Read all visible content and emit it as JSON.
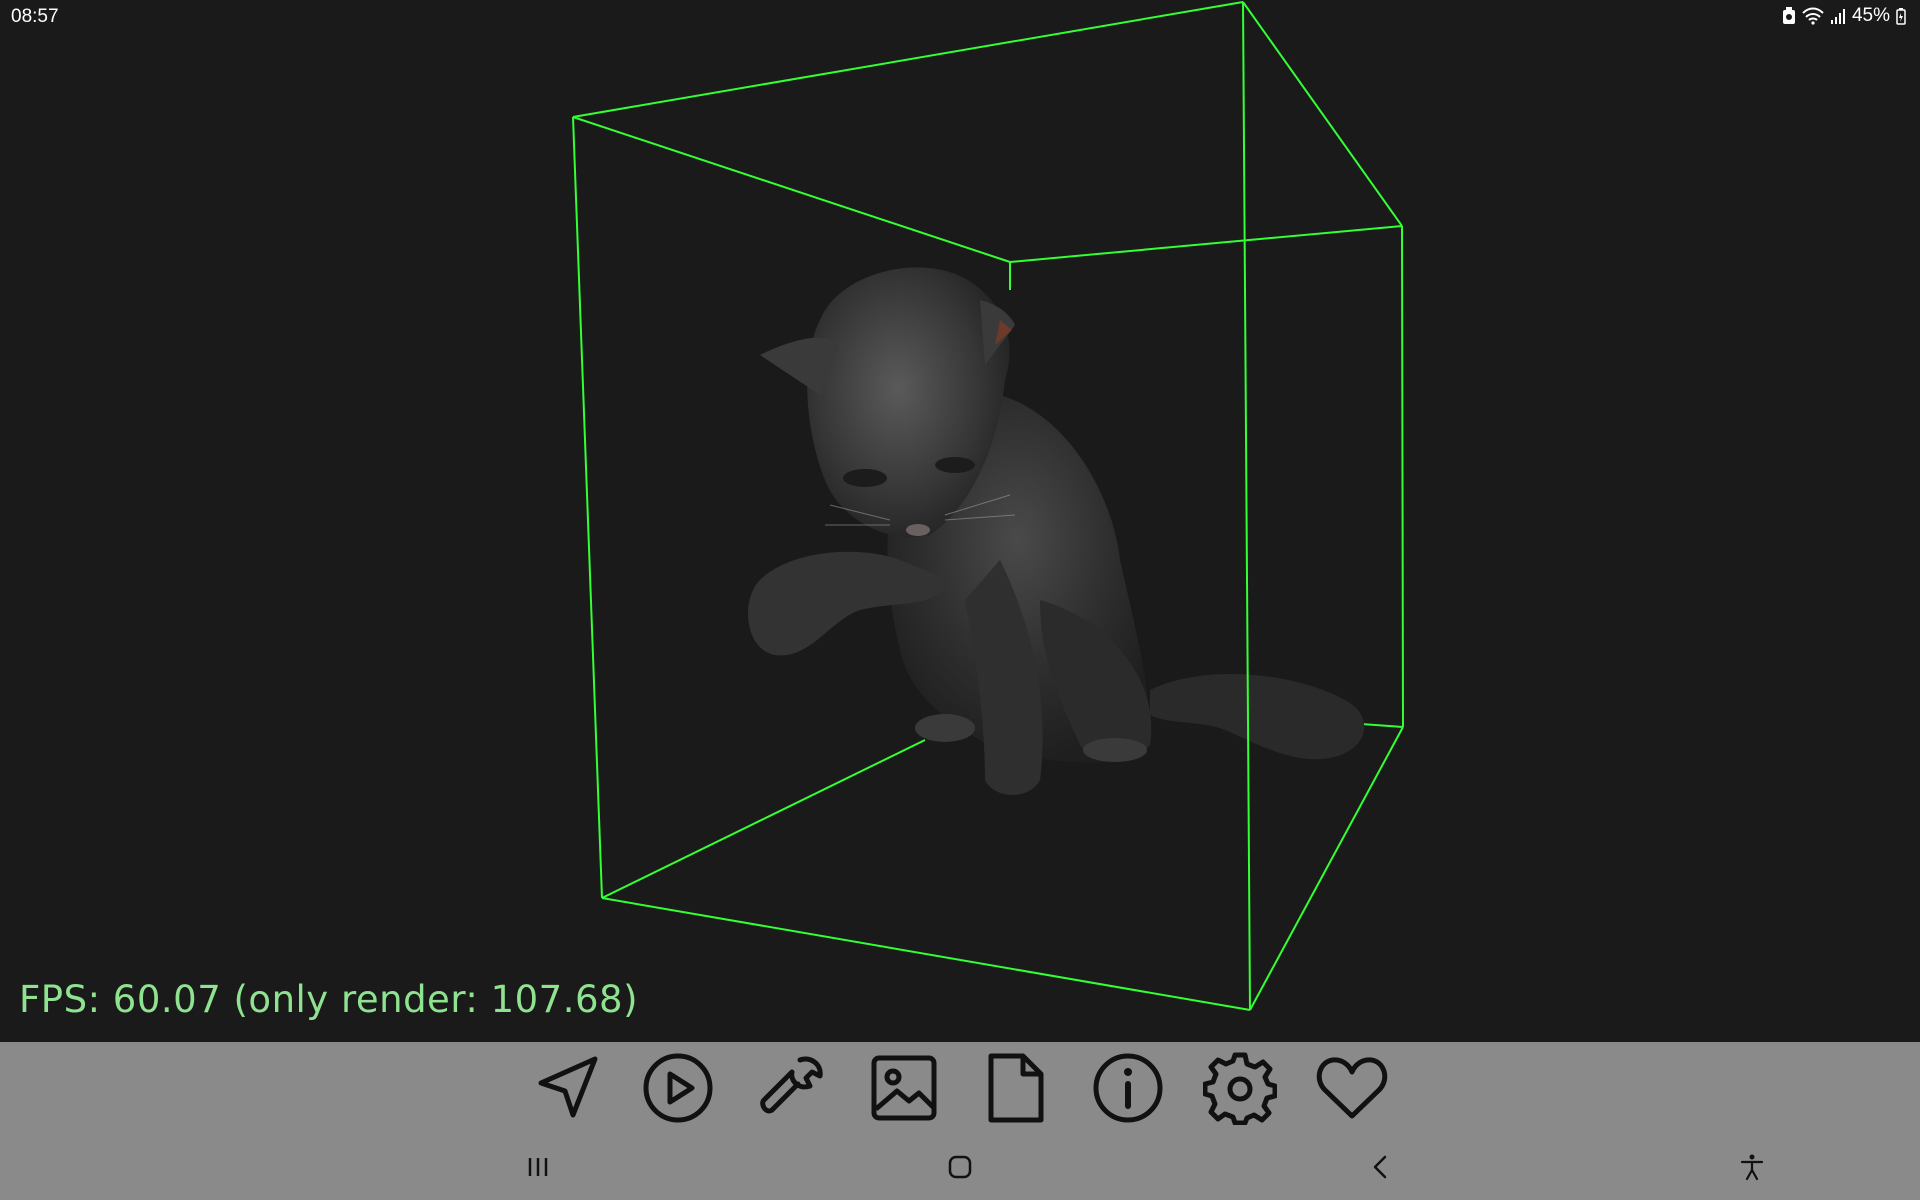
{
  "status_bar": {
    "time": "08:57",
    "battery_percent": "45%",
    "icons": [
      "battery-saver-icon",
      "wifi-icon",
      "signal-icon",
      "battery-icon"
    ]
  },
  "scene": {
    "model": "cat",
    "bounding_box_color": "#33ff33"
  },
  "fps_text": "FPS: 60.07 (only render: 107.68)",
  "toolbar": {
    "items": [
      {
        "name": "navigate-button",
        "icon": "navigation-arrow-icon"
      },
      {
        "name": "play-button",
        "icon": "play-circle-icon"
      },
      {
        "name": "tools-button",
        "icon": "wrench-icon"
      },
      {
        "name": "screenshot-button",
        "icon": "image-icon"
      },
      {
        "name": "file-button",
        "icon": "file-icon"
      },
      {
        "name": "info-button",
        "icon": "info-icon"
      },
      {
        "name": "settings-button",
        "icon": "gear-icon"
      },
      {
        "name": "favorite-button",
        "icon": "heart-icon"
      }
    ]
  },
  "nav_bar": {
    "items": [
      "recent-apps-icon",
      "home-icon",
      "back-icon",
      "accessibility-icon"
    ]
  },
  "colors": {
    "background": "#1a1a1a",
    "toolbar": "#8a8a8a",
    "fps_text": "#8fe28f",
    "wireframe": "#33ff33"
  }
}
